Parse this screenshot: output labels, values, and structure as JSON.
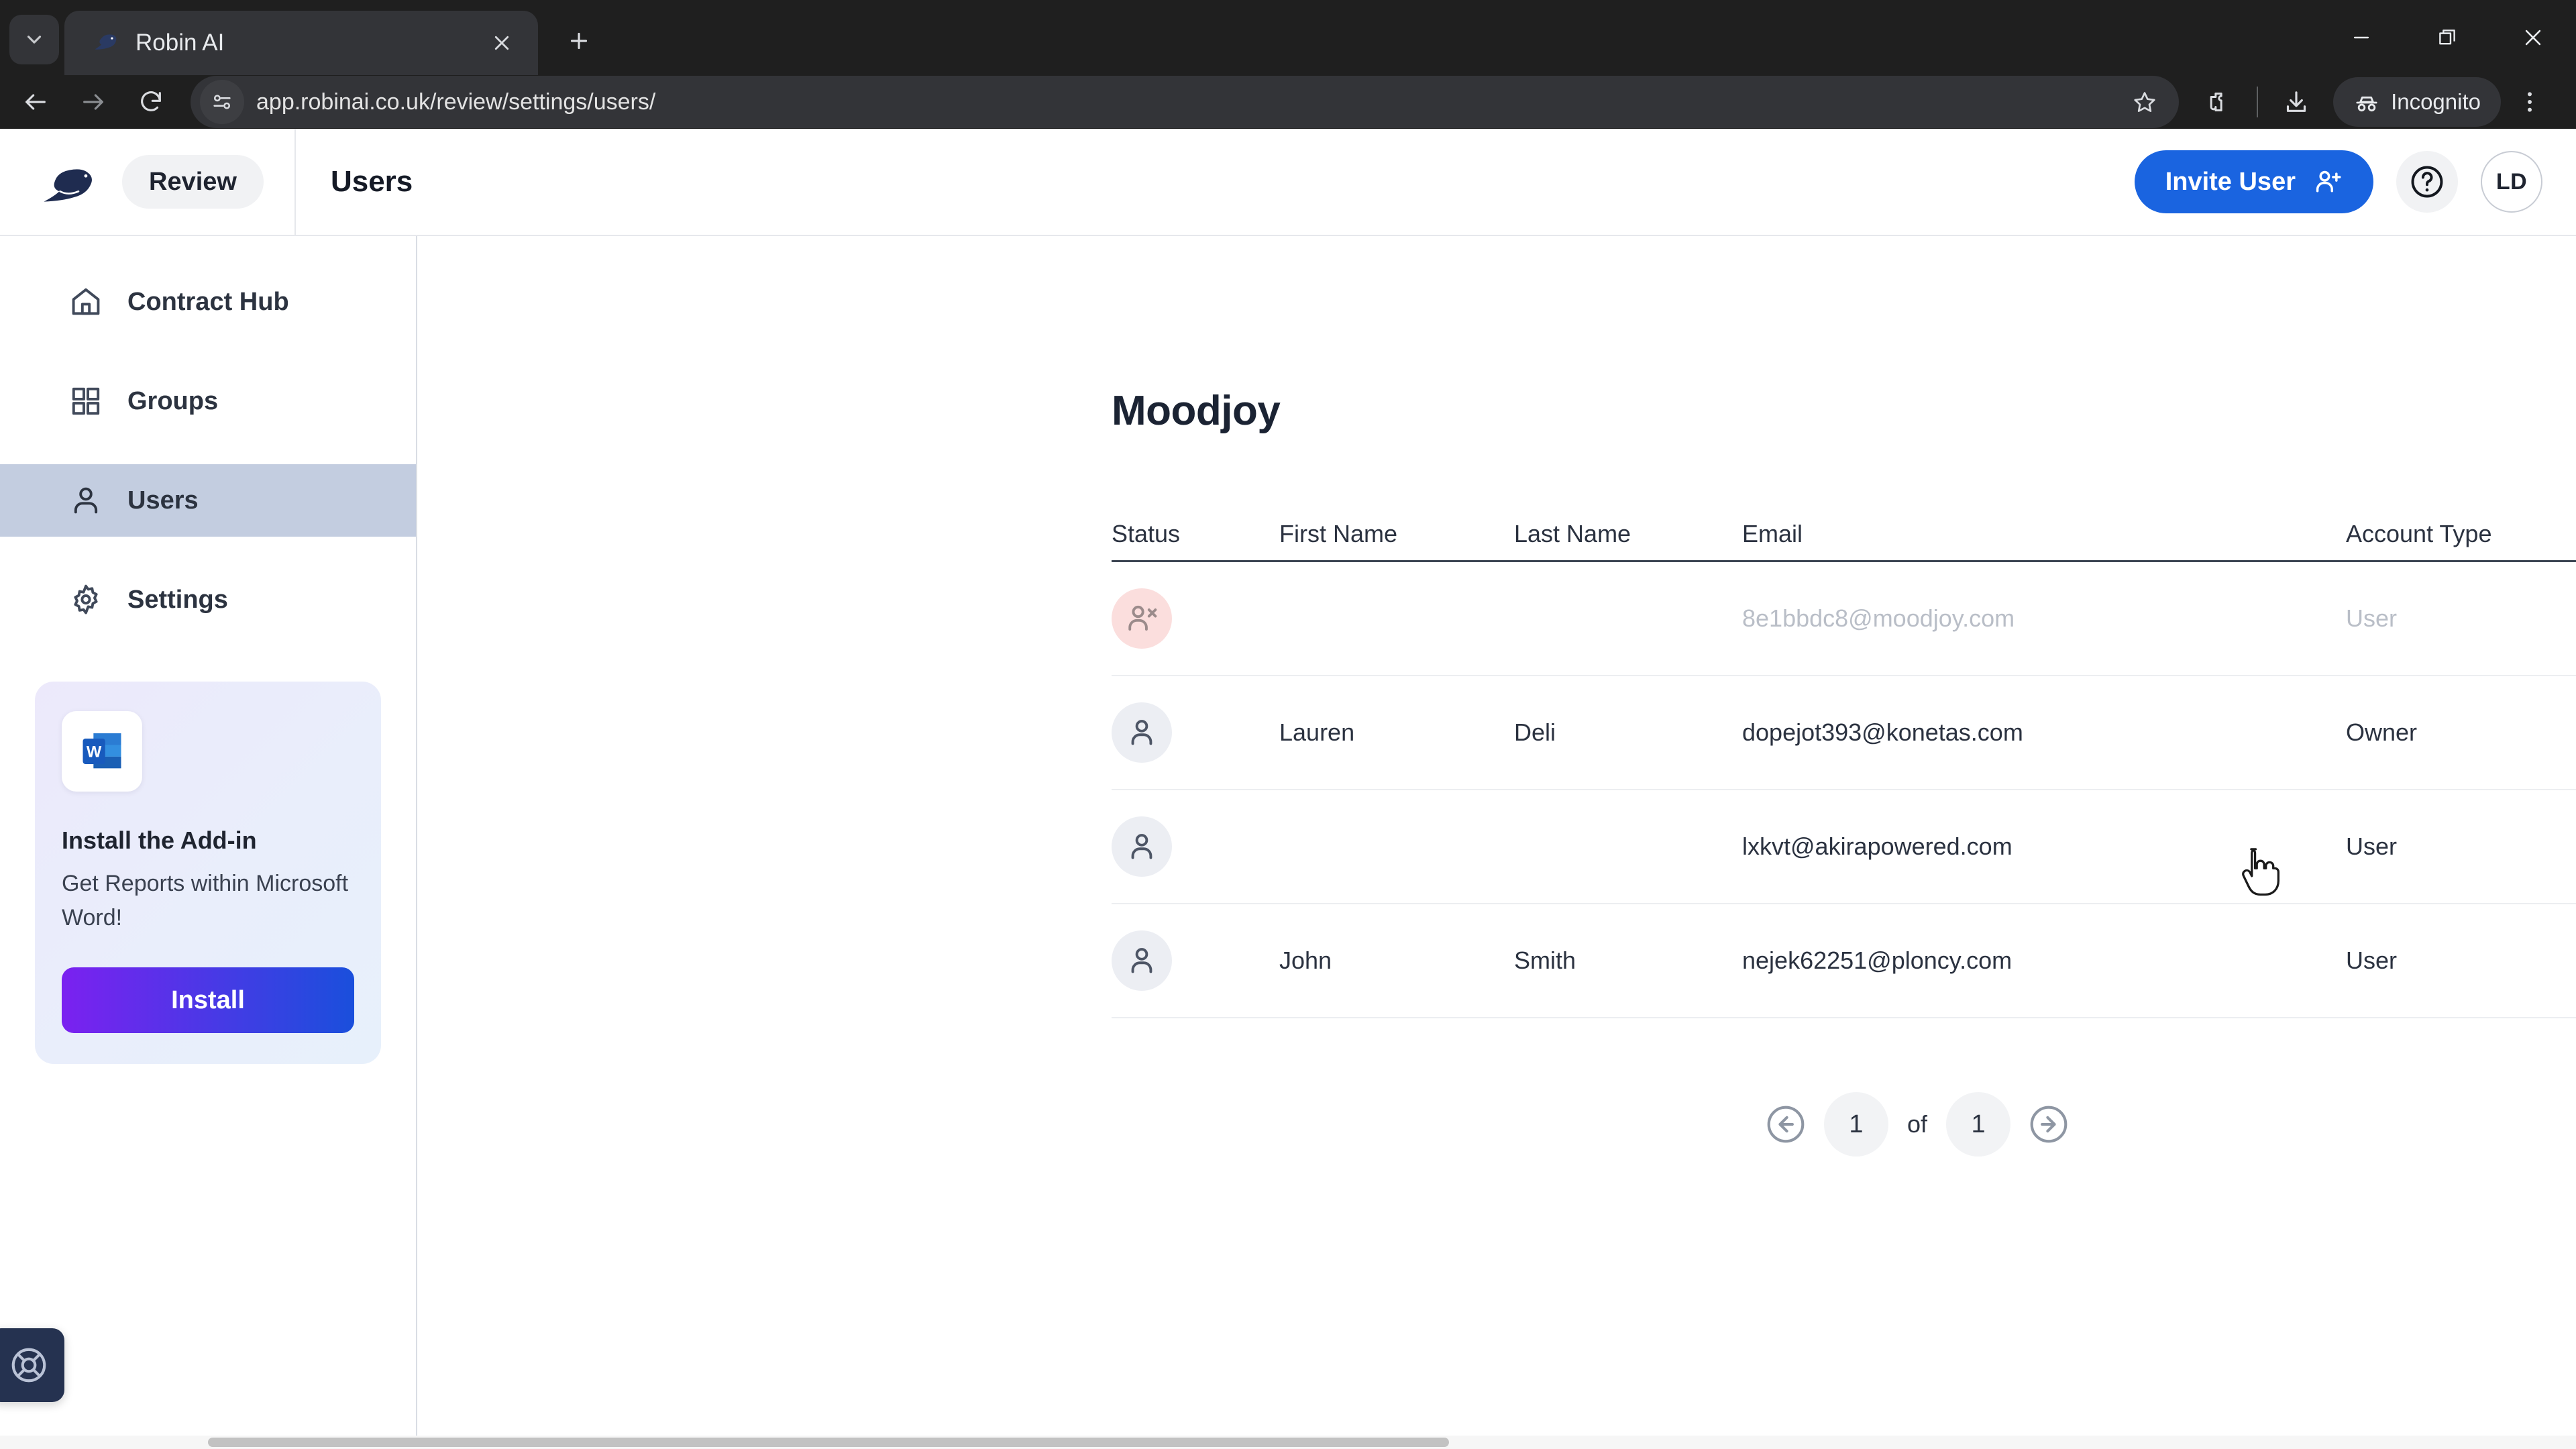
{
  "browser": {
    "tab": {
      "title": "Robin AI",
      "favicon_icon": "robin-bird-icon"
    },
    "tab_list_icon": "chevron-down-icon",
    "new_tab_icon": "plus-icon",
    "window_controls": {
      "minimize": "minimize-icon",
      "maximize": "maximize-icon",
      "close": "close-icon"
    },
    "nav": {
      "back_icon": "arrow-left-icon",
      "forward_icon": "arrow-right-icon",
      "reload_icon": "reload-icon"
    },
    "omnibox": {
      "site_info_icon": "site-settings-icon",
      "url": "app.robinai.co.uk/review/settings/users/",
      "bookmark_icon": "star-icon"
    },
    "extensions_icon": "extensions-puzzle-icon",
    "downloads_icon": "download-icon",
    "profile": {
      "label": "Incognito",
      "icon": "incognito-icon"
    },
    "menu_icon": "three-dot-menu-icon"
  },
  "header": {
    "logo_icon": "robin-bird-logo",
    "review_label": "Review",
    "page_title": "Users",
    "invite_label": "Invite User",
    "invite_icon": "user-plus-icon",
    "help_icon": "question-mark-icon",
    "avatar_initials": "LD",
    "accent_color": "#1a64e0"
  },
  "sidebar": {
    "items": [
      {
        "label": "Contract Hub",
        "icon": "home-icon",
        "active": false
      },
      {
        "label": "Groups",
        "icon": "grid-icon",
        "active": false
      },
      {
        "label": "Users",
        "icon": "user-icon",
        "active": true
      },
      {
        "label": "Settings",
        "icon": "gear-icon",
        "active": false
      }
    ],
    "active_bg": "#c3cde0",
    "promo": {
      "icon": "microsoft-word-icon",
      "title": "Install the Add-in",
      "subtitle": "Get Reports within Microsoft Word!",
      "button_label": "Install"
    },
    "support_icon": "lifebuoy-icon"
  },
  "main": {
    "org_title": "Moodjoy",
    "table": {
      "columns": [
        "Status",
        "First Name",
        "Last Name",
        "Email",
        "Account Type"
      ],
      "rows": [
        {
          "status_icon": "user-removed-icon",
          "status_state": "disabled",
          "first_name": "",
          "last_name": "",
          "email": "8e1bbdc8@moodjoy.com",
          "account_type": "User",
          "menu_icon": "kebab-menu-icon"
        },
        {
          "status_icon": "user-icon",
          "status_state": "active",
          "first_name": "Lauren",
          "last_name": "Deli",
          "email": "dopejot393@konetas.com",
          "account_type": "Owner",
          "menu_icon": "kebab-menu-icon"
        },
        {
          "status_icon": "user-icon",
          "status_state": "active",
          "first_name": "",
          "last_name": "",
          "email": "lxkvt@akirapowered.com",
          "account_type": "User",
          "menu_icon": "kebab-menu-icon"
        },
        {
          "status_icon": "user-icon",
          "status_state": "active",
          "first_name": "John",
          "last_name": "Smith",
          "email": "nejek62251@ploncy.com",
          "account_type": "User",
          "menu_icon": "kebab-menu-icon"
        }
      ]
    },
    "pagination": {
      "prev_icon": "circle-arrow-left-icon",
      "next_icon": "circle-arrow-right-icon",
      "current_page": "1",
      "of_label": "of",
      "total_pages": "1"
    }
  }
}
